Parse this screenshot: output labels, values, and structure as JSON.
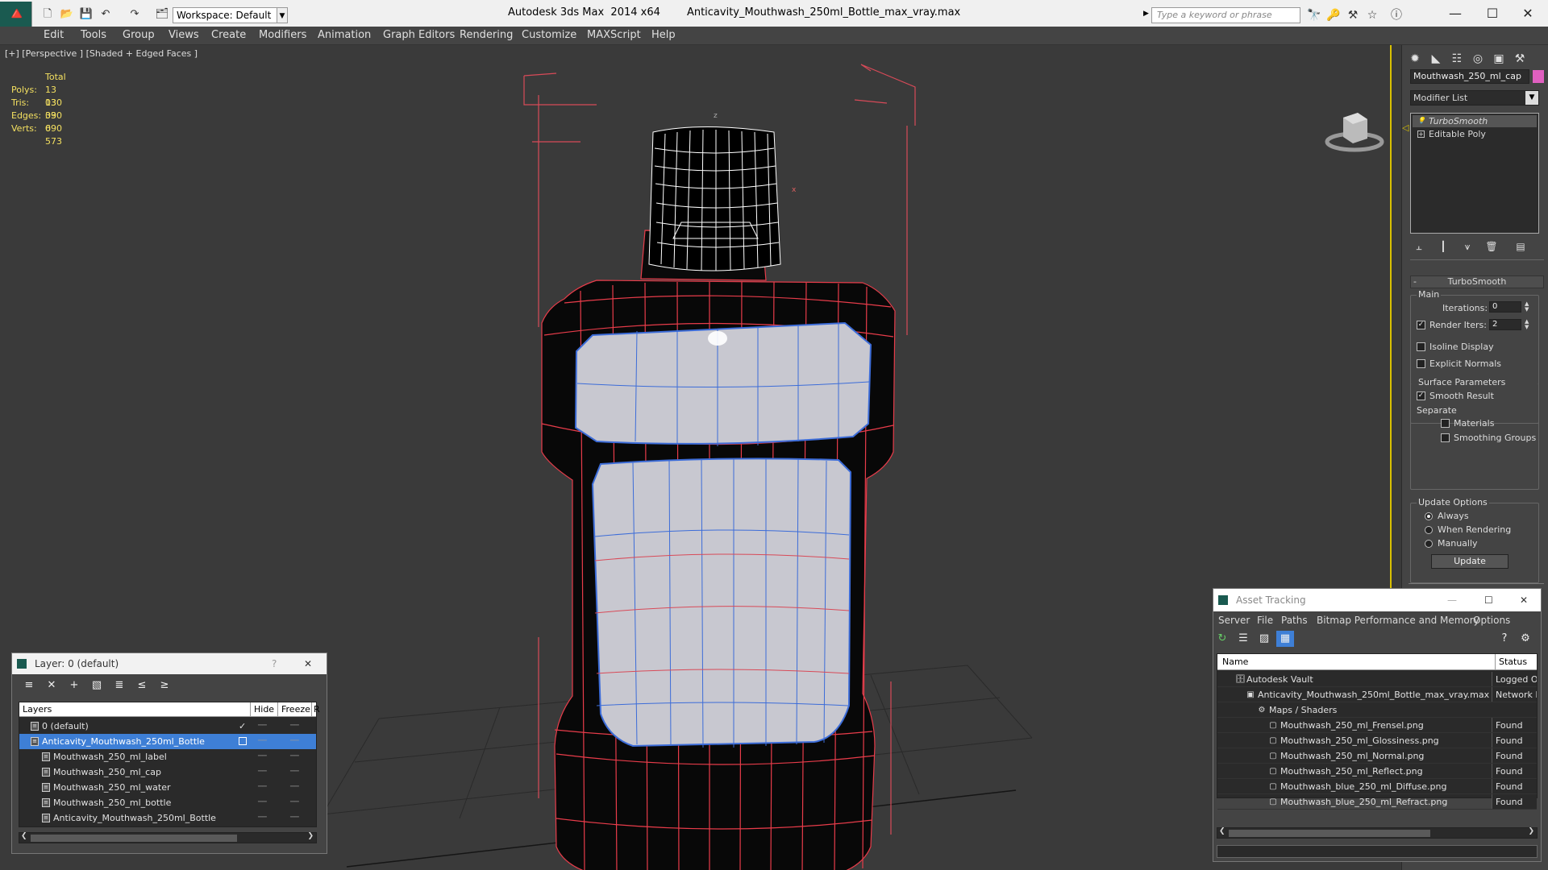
{
  "titlebar": {
    "workspace_label": "Workspace: Default",
    "app_title": "Autodesk 3ds Max  2014 x64        Anticavity_Mouthwash_250ml_Bottle_max_vray.max",
    "search_placeholder": "Type a keyword or phrase",
    "window_buttons": [
      "—",
      "☐",
      "✕"
    ]
  },
  "menu": [
    "Edit",
    "Tools",
    "Group",
    "Views",
    "Create",
    "Modifiers",
    "Animation",
    "Graph Editors",
    "Rendering",
    "Customize",
    "MAXScript",
    "Help"
  ],
  "viewport": {
    "label": "[+] [Perspective ] [Shaded + Edged Faces ]",
    "stats": {
      "header": "Total",
      "rows": [
        {
          "label": "Polys:",
          "value": "13 030"
        },
        {
          "label": "Tris:",
          "value": "13 030"
        },
        {
          "label": "Edges:",
          "value": "39 090"
        },
        {
          "label": "Verts:",
          "value": "6 573"
        }
      ]
    },
    "colors": {
      "wire_red": "#e83c4a",
      "wire_blue": "#3c6cd8",
      "label_fill": "#c8c8d0"
    }
  },
  "command_panel": {
    "object_name": "Mouthwash_250_ml_cap",
    "object_color": "#e060c0",
    "modifier_list": "Modifier List",
    "stack": [
      "TurboSmooth",
      "Editable Poly"
    ],
    "rollout_title": "TurboSmooth",
    "main_group": "Main",
    "iterations_label": "Iterations:",
    "iterations_value": "0",
    "render_iters_label": "Render Iters:",
    "render_iters_value": "2",
    "isoline_display": "Isoline Display",
    "explicit_normals": "Explicit Normals",
    "surface_group": "Surface Parameters",
    "smooth_result": "Smooth Result",
    "separate_label": "Separate",
    "materials": "Materials",
    "smoothing_groups": "Smoothing Groups",
    "update_group": "Update Options",
    "always": "Always",
    "when_rendering": "When Rendering",
    "manually": "Manually",
    "update_button": "Update"
  },
  "layer_panel": {
    "title": "Layer: 0 (default)",
    "help": "?",
    "close": "✕",
    "col_layers": "Layers",
    "col_hide": "Hide",
    "col_freeze": "Freeze",
    "col_r": "R",
    "rows": [
      {
        "name": "0 (default)",
        "indent": 0,
        "selected": false,
        "check": "✓"
      },
      {
        "name": "Anticavity_Mouthwash_250ml_Bottle",
        "indent": 0,
        "selected": true,
        "check": ""
      },
      {
        "name": "Mouthwash_250_ml_label",
        "indent": 1,
        "selected": false,
        "check": ""
      },
      {
        "name": "Mouthwash_250_ml_cap",
        "indent": 1,
        "selected": false,
        "check": ""
      },
      {
        "name": "Mouthwash_250_ml_water",
        "indent": 1,
        "selected": false,
        "check": ""
      },
      {
        "name": "Mouthwash_250_ml_bottle",
        "indent": 1,
        "selected": false,
        "check": ""
      },
      {
        "name": "Anticavity_Mouthwash_250ml_Bottle",
        "indent": 1,
        "selected": false,
        "check": ""
      }
    ]
  },
  "asset_panel": {
    "title": "Asset Tracking",
    "menu": [
      "Server",
      "File",
      "Paths",
      "Bitmap Performance and Memory",
      "Options"
    ],
    "col_name": "Name",
    "col_status": "Status",
    "rows": [
      {
        "name": "Autodesk Vault",
        "indent": 0,
        "status": "Logged O"
      },
      {
        "name": "Anticavity_Mouthwash_250ml_Bottle_max_vray.max",
        "indent": 1,
        "status": "Network F"
      },
      {
        "name": "Maps / Shaders",
        "indent": 2,
        "status": ""
      },
      {
        "name": "Mouthwash_250_ml_Frensel.png",
        "indent": 3,
        "status": "Found"
      },
      {
        "name": "Mouthwash_250_ml_Glossiness.png",
        "indent": 3,
        "status": "Found"
      },
      {
        "name": "Mouthwash_250_ml_Normal.png",
        "indent": 3,
        "status": "Found"
      },
      {
        "name": "Mouthwash_250_ml_Reflect.png",
        "indent": 3,
        "status": "Found"
      },
      {
        "name": "Mouthwash_blue_250_ml_Diffuse.png",
        "indent": 3,
        "status": "Found"
      },
      {
        "name": "Mouthwash_blue_250_ml_Refract.png",
        "indent": 3,
        "status": "Found"
      }
    ]
  }
}
